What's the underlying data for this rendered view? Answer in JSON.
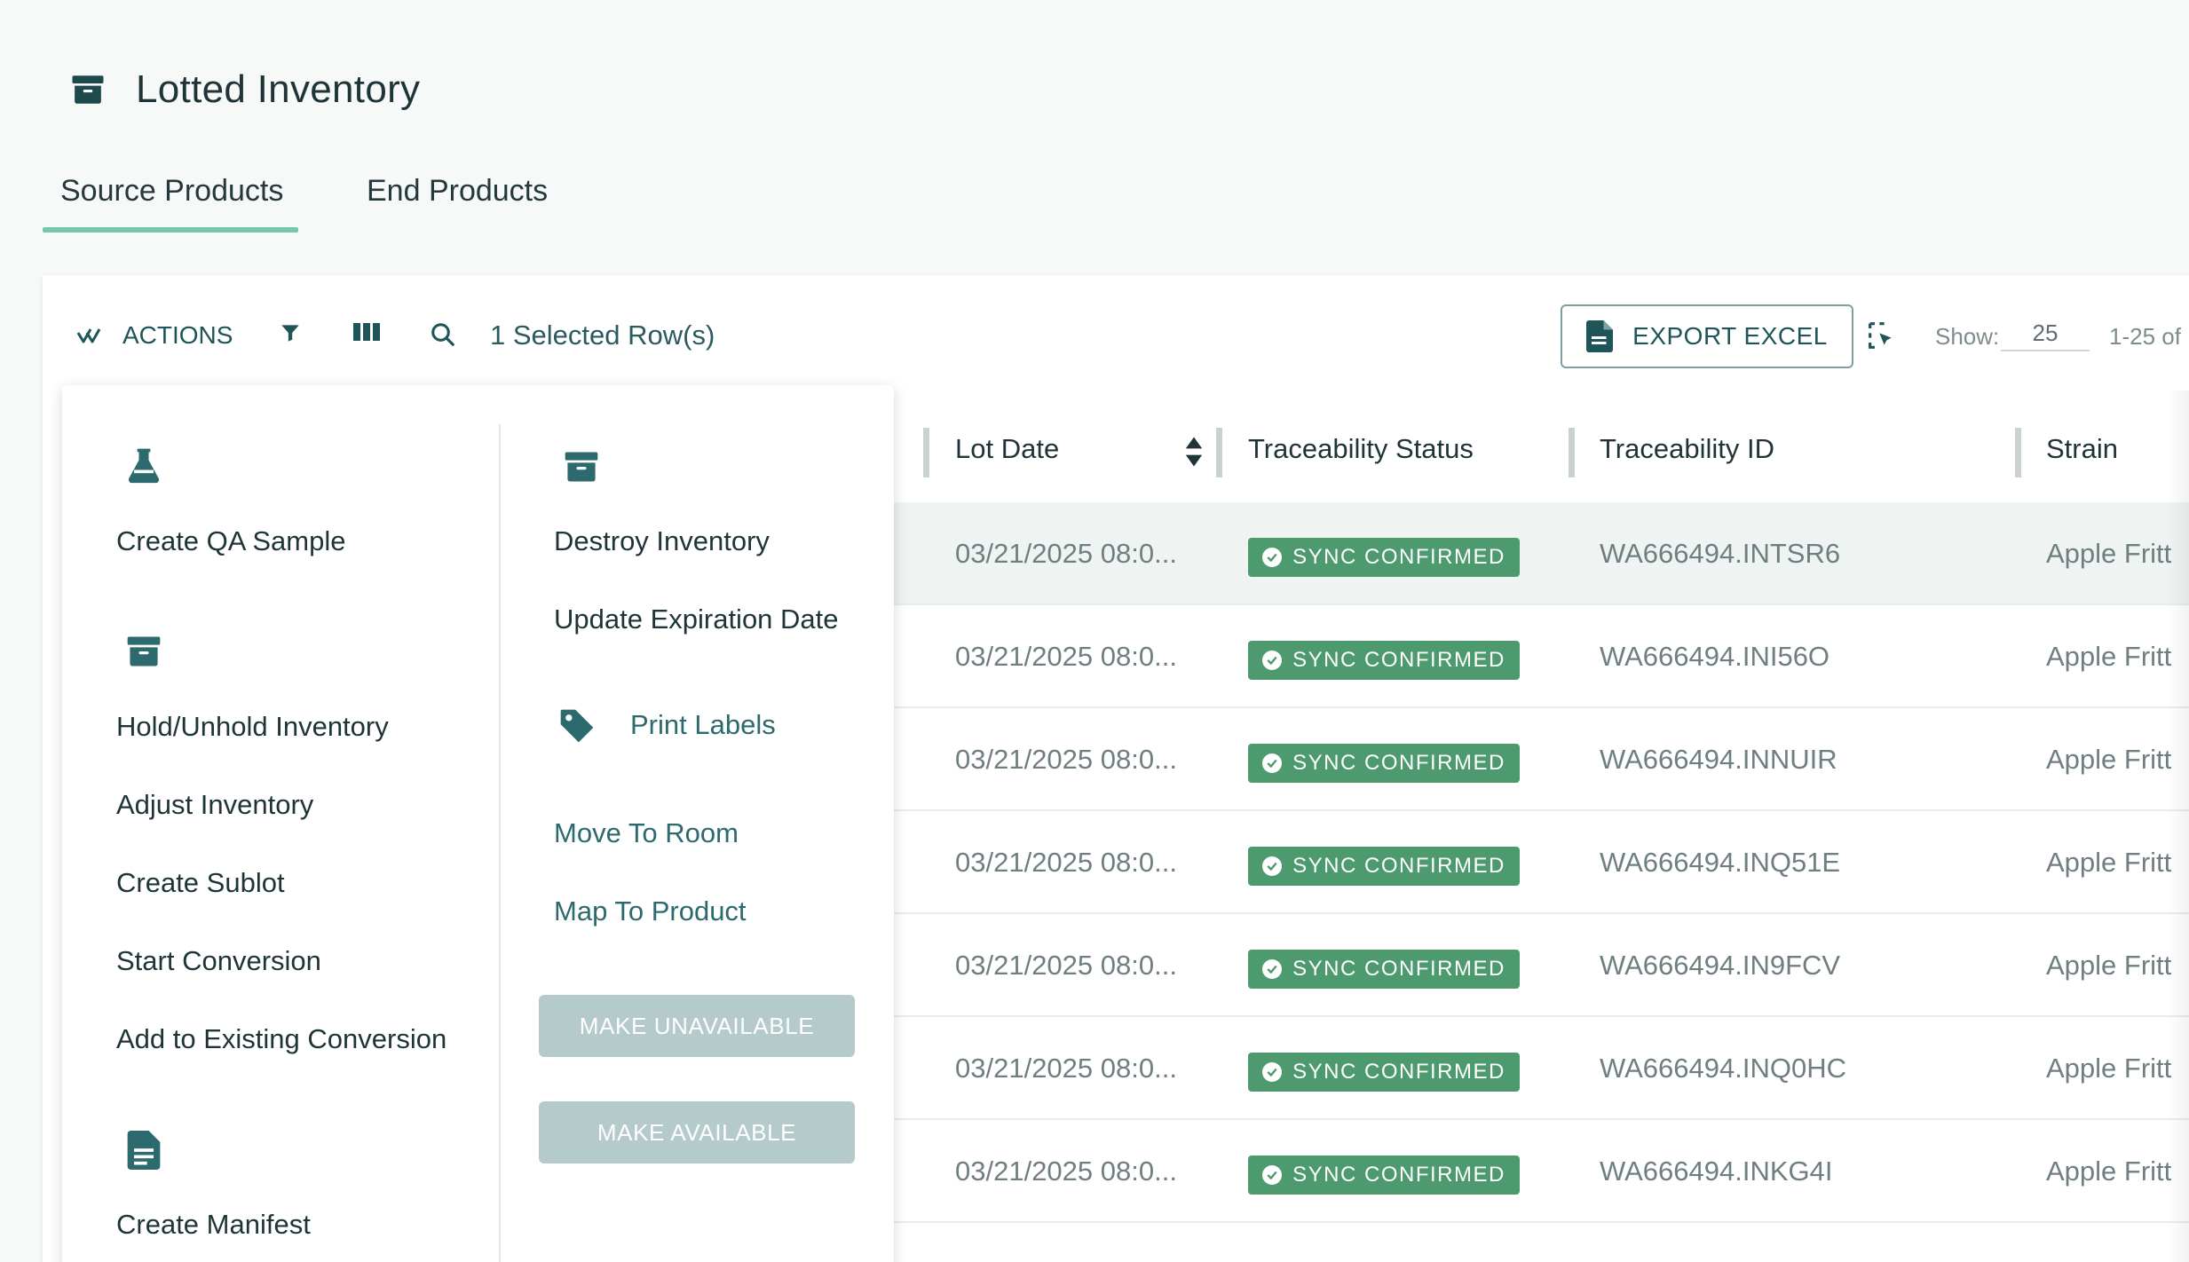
{
  "page": {
    "title": "Lotted Inventory",
    "tabs": [
      {
        "label": "Source Products",
        "active": true
      },
      {
        "label": "End Products",
        "active": false
      }
    ]
  },
  "toolbar": {
    "actions_label": "ACTIONS",
    "selected_rows": "1 Selected Row(s)",
    "export_label": "EXPORT EXCEL",
    "show_label": "Show:",
    "show_value": "25",
    "range_label": "1-25 of"
  },
  "table": {
    "columns": [
      "Lot Date",
      "Traceability Status",
      "Traceability ID",
      "Strain"
    ],
    "rows": [
      {
        "lot_date": "03/21/2025 08:0...",
        "status": "SYNC CONFIRMED",
        "traceability_id": "WA666494.INTSR6",
        "strain": "Apple Fritt",
        "selected": true
      },
      {
        "lot_date": "03/21/2025 08:0...",
        "status": "SYNC CONFIRMED",
        "traceability_id": "WA666494.INI56O",
        "strain": "Apple Fritt",
        "selected": false
      },
      {
        "lot_date": "03/21/2025 08:0...",
        "status": "SYNC CONFIRMED",
        "traceability_id": "WA666494.INNUIR",
        "strain": "Apple Fritt",
        "selected": false
      },
      {
        "lot_date": "03/21/2025 08:0...",
        "status": "SYNC CONFIRMED",
        "traceability_id": "WA666494.INQ51E",
        "strain": "Apple Fritt",
        "selected": false
      },
      {
        "lot_date": "03/21/2025 08:0...",
        "status": "SYNC CONFIRMED",
        "traceability_id": "WA666494.IN9FCV",
        "strain": "Apple Fritt",
        "selected": false
      },
      {
        "lot_date": "03/21/2025 08:0...",
        "status": "SYNC CONFIRMED",
        "traceability_id": "WA666494.INQ0HC",
        "strain": "Apple Fritt",
        "selected": false
      },
      {
        "lot_date": "03/21/2025 08:0...",
        "status": "SYNC CONFIRMED",
        "traceability_id": "WA666494.INKG4I",
        "strain": "Apple Fritt",
        "selected": false
      }
    ]
  },
  "actions_menu": {
    "left": {
      "create_qa_sample": "Create QA Sample",
      "hold_unhold": "Hold/Unhold Inventory",
      "adjust": "Adjust Inventory",
      "create_sublot": "Create Sublot",
      "start_conversion": "Start Conversion",
      "add_to_conversion": "Add to Existing Conversion",
      "create_manifest": "Create Manifest"
    },
    "right": {
      "destroy": "Destroy Inventory",
      "update_expiration": "Update Expiration Date",
      "print_labels": "Print Labels",
      "move_to_room": "Move To Room",
      "map_to_product": "Map To Product",
      "make_unavailable": "MAKE UNAVAILABLE",
      "make_available": "MAKE AVAILABLE"
    }
  },
  "colors": {
    "accent": "#74c7ac",
    "primary_text": "#1e5558",
    "badge": "#4d9a6f",
    "disabled_button": "#b5cbcb"
  },
  "icons": {
    "page": "archive-box-icon",
    "actions": "double-check-icon",
    "filter": "filter-icon",
    "columns": "columns-icon",
    "search": "search-icon",
    "export": "document-icon",
    "select": "select-cursor-icon",
    "qa_sample": "flask-icon",
    "hold": "archive-box-icon",
    "manifest": "document-icon",
    "destroy": "archive-box-icon",
    "labels": "tag-icon"
  }
}
